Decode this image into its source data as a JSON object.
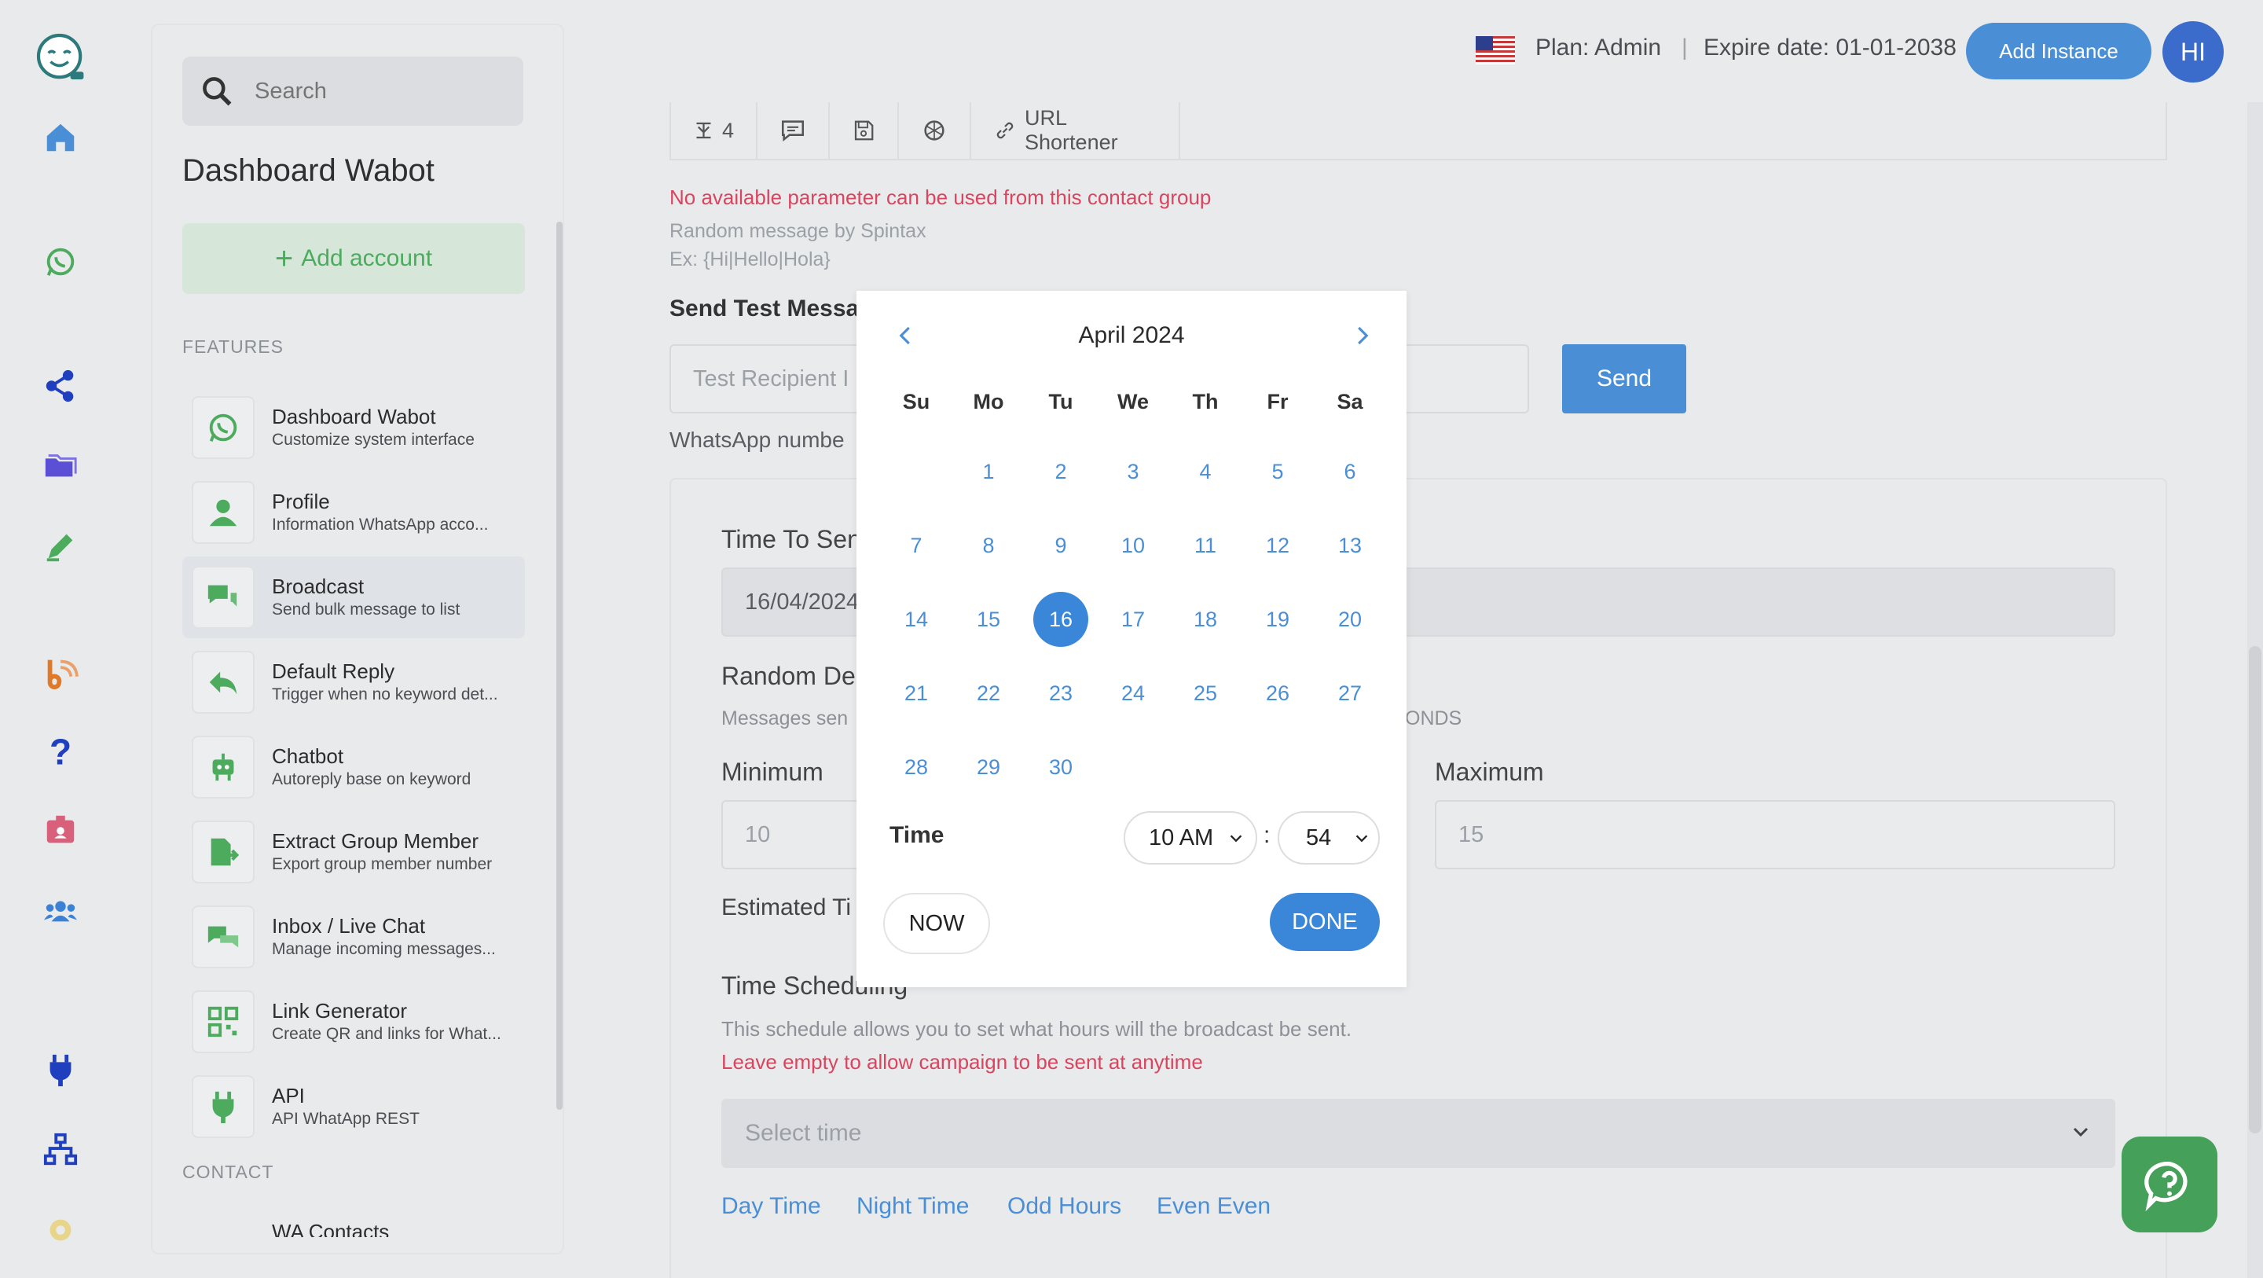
{
  "header": {
    "plan": "Plan: Admin",
    "separator": "|",
    "expire": "Expire date: 01-01-2038",
    "add_instance": "Add Instance",
    "avatar": "HI"
  },
  "sidebar": {
    "search_placeholder": "Search",
    "title": "Dashboard Wabot",
    "add_account": "Add account",
    "section_features": "FEATURES",
    "section_contact": "CONTACT",
    "contact_partial": "WA Contacts",
    "items": [
      {
        "name": "Dashboard Wabot",
        "desc": "Customize system interface",
        "icon": "whatsapp-icon"
      },
      {
        "name": "Profile",
        "desc": "Information WhatsApp acco...",
        "icon": "user-icon"
      },
      {
        "name": "Broadcast",
        "desc": "Send bulk message to list",
        "icon": "chat-bubbles-icon"
      },
      {
        "name": "Default Reply",
        "desc": "Trigger when no keyword det...",
        "icon": "reply-icon"
      },
      {
        "name": "Chatbot",
        "desc": "Autoreply base on keyword",
        "icon": "robot-icon"
      },
      {
        "name": "Extract Group Member",
        "desc": "Export group member number",
        "icon": "export-icon"
      },
      {
        "name": "Inbox / Live Chat",
        "desc": "Manage incoming messages...",
        "icon": "live-chat-icon"
      },
      {
        "name": "Link Generator",
        "desc": "Create QR and links for What...",
        "icon": "qr-icon"
      },
      {
        "name": "API",
        "desc": "API WhatApp REST",
        "icon": "plug-icon"
      }
    ]
  },
  "toolbar": {
    "count": "4",
    "url_shortener": "URL Shortener"
  },
  "form": {
    "param_error": "No available parameter can be used from this contact group",
    "spintax_hint": "Random message by Spintax",
    "spintax_example": "Ex: {Hi|Hello|Hola}",
    "send_test_label": "Send Test Messa",
    "test_recipient_placeholder": "Test Recipient I",
    "send_button": "Send",
    "whatsapp_hint": "WhatsApp numbe",
    "time_to_send_label": "Time To Sen",
    "time_to_send_value": "16/04/2024",
    "random_delay_label": "Random De",
    "random_delay_hint_left": "Messages sen",
    "random_delay_hint_right": "ONDS",
    "minimum_label": "Minimum",
    "minimum_value": "10",
    "maximum_label": "Maximum",
    "maximum_value": "15",
    "estimated_label": "Estimated Ti",
    "time_sched_label": "Time Scheduling",
    "time_sched_hint": "This schedule allows you to set what hours will the broadcast be sent.",
    "time_sched_warn": "Leave empty to allow campaign to be sent at anytime",
    "select_time_placeholder": "Select time",
    "presets": [
      "Day Time",
      "Night Time",
      "Odd Hours",
      "Even Even"
    ]
  },
  "datepicker": {
    "month": "April 2024",
    "weekdays": [
      "Su",
      "Mo",
      "Tu",
      "We",
      "Th",
      "Fr",
      "Sa"
    ],
    "selected_day": 16,
    "time_label": "Time",
    "hour": "10 AM",
    "colon": ":",
    "minute": "54",
    "now_button": "NOW",
    "done_button": "DONE"
  },
  "colors": {
    "accent": "#4a8fd6",
    "error": "#d9455f",
    "green": "#4cab5d"
  }
}
